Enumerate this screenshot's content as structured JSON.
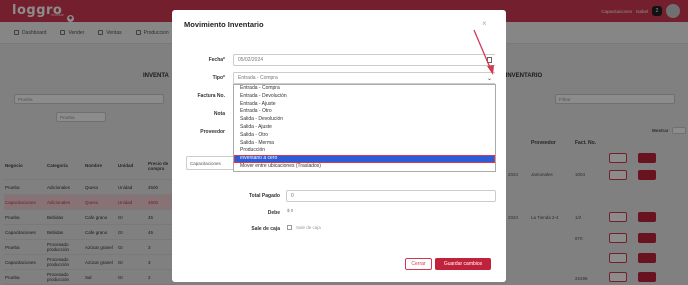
{
  "header": {
    "logo": "loggro",
    "logo_sub": "restobar",
    "user_company": "Capacitaciones",
    "user_name": "Isabel",
    "notif_count": "2"
  },
  "nav": [
    {
      "label": "Dashboard",
      "icon": "dashboard-icon"
    },
    {
      "label": "Vender",
      "icon": "cart-icon"
    },
    {
      "label": "Ventas",
      "icon": "receipt-icon"
    },
    {
      "label": "Produccion",
      "icon": "production-icon"
    }
  ],
  "background": {
    "left_title": "INVENTA",
    "right_title": "S INVENTARIO",
    "left_select_1": "Prueba",
    "left_select_2": "Prueba",
    "right_filter": "Filtrar",
    "mostrar_label": "Mostrar",
    "table_headers": [
      "Negocio",
      "Categoría",
      "Nombre",
      "Unidad",
      "Precio de compra"
    ],
    "table_rows": [
      [
        "Prueba",
        "Adicionales",
        "Queso",
        "Unidad",
        "4500"
      ],
      [
        "Capacitaciones",
        "Adicionales",
        "Queso",
        "Unidad",
        "4500"
      ],
      [
        "Prueba",
        "Bebidas",
        "Cafe grano",
        "Gr",
        "45"
      ],
      [
        "Capacitaciones",
        "Bebidas",
        "Cafe grano",
        "Gr",
        "45"
      ],
      [
        "Prueba",
        "Procesado producción",
        "Azúcar granel",
        "Gr",
        "3"
      ],
      [
        "Capacitaciones",
        "Procesado producción",
        "Azúcar granel",
        "Gr",
        "3"
      ],
      [
        "Prueba",
        "Procesado producción",
        "Sal",
        "Gr",
        "2"
      ]
    ],
    "right_headers": [
      "Proveedor",
      "Fact. No."
    ],
    "right_rows": [
      [
        "2024",
        "Jamonales",
        "1004"
      ],
      [
        "2024",
        "La Tienda 2-4",
        "1/2"
      ],
      [
        "",
        "",
        "870"
      ],
      [
        "",
        "",
        "22496"
      ]
    ]
  },
  "modal": {
    "title": "Movimiento Inventario",
    "close": "×",
    "fecha_label": "Fecha*",
    "fecha_value": "05/02/2024",
    "tipo_label": "Tipo*",
    "tipo_value": "Entrada - Compra",
    "factura_label": "Factura No.",
    "nota_label": "Nota",
    "proveedor_label": "Proveedor",
    "concept_box": "Capacitaciones",
    "total_label": "Total Pagado",
    "total_value": "0",
    "debe_label": "Debe",
    "debe_value": "$ 0",
    "salecaja_label": "Sale de caja",
    "salecaja_check": "Sale de caja",
    "btn_cerrar": "Cerrar",
    "btn_guardar": "Guardar cambios",
    "options": [
      "Entrada - Compra",
      "Entrada - Devolución",
      "Entrada - Ajuste",
      "Entrada - Otro",
      "Salida - Devolución",
      "Salida - Ajuste",
      "Salida - Otro",
      "Salida - Merma",
      "Producción",
      "Inventario a cero",
      "Mover entre ubicaciones (Traslados)"
    ],
    "selected_index": 9
  },
  "colors": {
    "brand": "#d13a52",
    "selection": "#2e5bd6",
    "annotation_arrow": "#d13a52"
  }
}
